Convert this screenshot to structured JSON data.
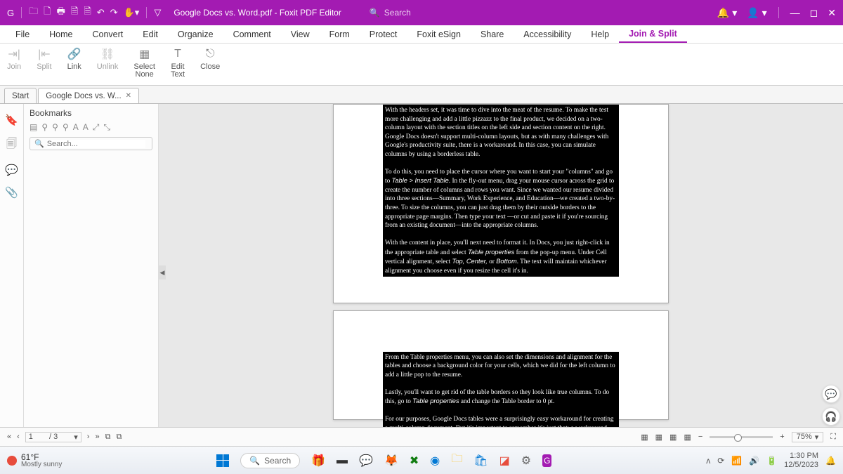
{
  "titlebar": {
    "doc_title": "Google Docs vs. Word.pdf - Foxit PDF Editor",
    "search_placeholder": "Search"
  },
  "ribbon_tabs": [
    "File",
    "Home",
    "Convert",
    "Edit",
    "Organize",
    "Comment",
    "View",
    "Form",
    "Protect",
    "Foxit eSign",
    "Share",
    "Accessibility",
    "Help",
    "Join & Split"
  ],
  "active_ribbon_tab": 13,
  "ribbon_groups": [
    {
      "label1": "Join",
      "icon": "⇥|"
    },
    {
      "label1": "Split",
      "icon": "|⇤"
    },
    {
      "label1": "Link",
      "icon": "🔗"
    },
    {
      "label1": "Unlink",
      "icon": "⛓"
    },
    {
      "label1": "Select",
      "label2": "None",
      "icon": "▦"
    },
    {
      "label1": "Edit",
      "label2": "Text",
      "icon": "T"
    },
    {
      "label1": "Close",
      "icon": "⎋"
    }
  ],
  "doc_tabs": [
    {
      "label": "Start",
      "active": false,
      "closable": false
    },
    {
      "label": "Google Docs vs. W...",
      "active": true,
      "closable": true
    }
  ],
  "bookmarks": {
    "title": "Bookmarks",
    "search_placeholder": "Search..."
  },
  "page1_text": "With the headers set, it was time to dive into the meat of the resume. To make the test more challenging and add a little pizzazz to the final product, we decided on a two-column layout with the section titles on the left side and section content on the right. Google Docs doesn't support multi-column layouts, but as with many challenges with Google's productivity suite, there is a workaround. In this case, you can simulate columns by using a borderless table.\n\nTo do this, you need to place the cursor where you want to start your \"columns\" and go to <i>Table > Insert Table</i>. In the fly-out menu, drag your mouse cursor across the grid to create the number of columns and rows you want. Since we wanted our resume divided into three sections—Summary, Work Experience, and Education—we created a two-by-three. To size the columns, you can just drag them by their outside borders to the appropriate page margins. Then type your text —or cut and paste it if you're sourcing from an existing document—into the appropriate columns.\n\nWith the content in place, you'll next need to format it. In Docs, you just right-click in the appropriate table and select <i>Table properties</i> from the pop-up menu. Under Cell vertical alignment, select <i>Top, Center,</i> or <i>Bottom</i>. The text will maintain whichever alignment you choose even if you resize the cell it's in.",
  "page2_text": "From the Table properties menu, you can also set the dimensions and alignment for the tables and choose a background color for your cells, which we did for the left column to add a little pop to the resume.\n\nLastly, you'll want to get rid of the table borders so they look like true columns. To do this, go to <i>Table properties</i> and change the Table border to 0 pt.\n\nFor our purposes, Google Docs tables were a surprisingly easy workaround for creating a multi-column document. But it's important to remember it's just that: a workaround. Though they will work for resumes and likely any other tightly",
  "status": {
    "page_current": "1",
    "page_total": "/ 3",
    "zoom": "75%"
  },
  "taskbar": {
    "temp": "61°F",
    "cond": "Mostly sunny",
    "search": "Search",
    "time": "1:30 PM",
    "date": "12/5/2023"
  }
}
